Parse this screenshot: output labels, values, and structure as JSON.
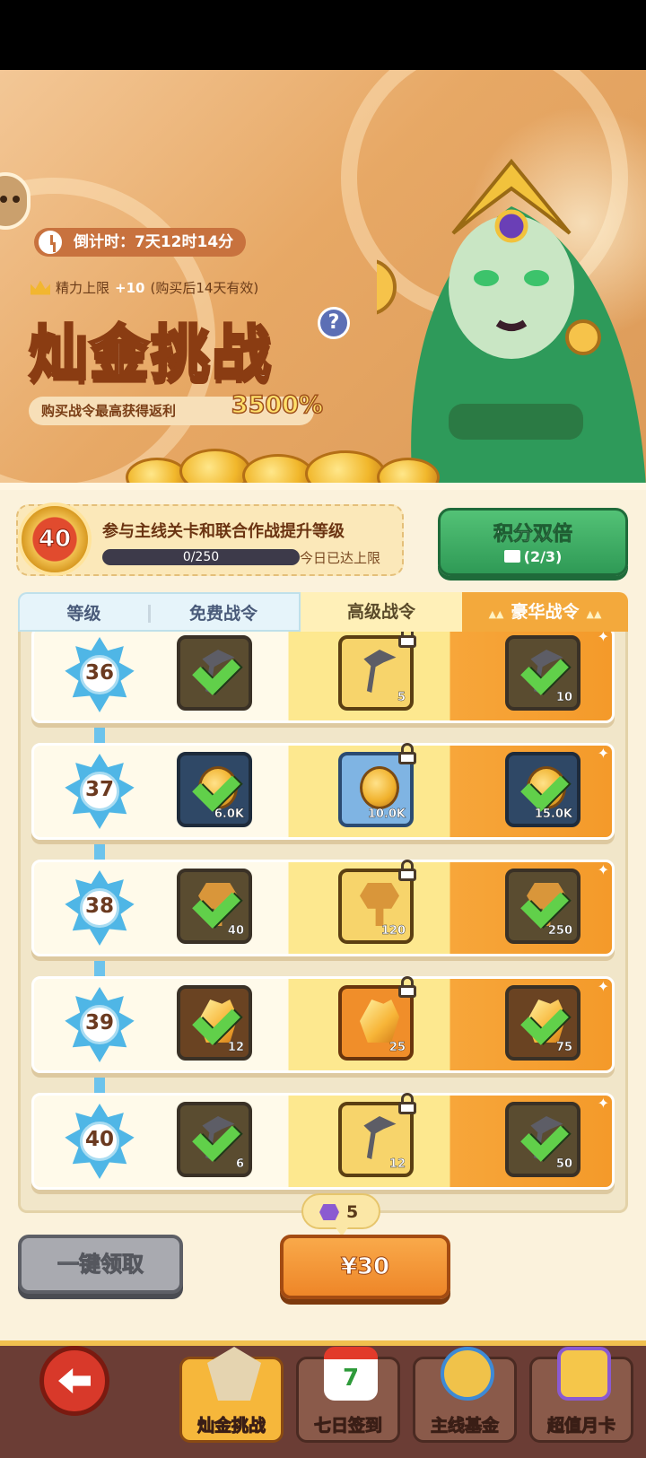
{
  "banner": {
    "countdown": "倒计时：7天12时14分",
    "stamina_label": "精力上限",
    "stamina_plus": "+10",
    "stamina_note": "(购买后14天有效)",
    "title": "灿金挑战",
    "help": "?",
    "rebate_text": "购买战令最高获得返利",
    "rebate_pct": "3500%"
  },
  "level_panel": {
    "level": "40",
    "description": "参与主线关卡和联合作战提升等级",
    "progress_text": "0/250",
    "progress_fraction": 0,
    "cap_text": "今日已达上限"
  },
  "double_points": {
    "label": "积分双倍",
    "count": "(2/3)"
  },
  "tabs": {
    "level": "等级",
    "free": "免费战令",
    "advanced": "高级战令",
    "luxury": "豪华战令"
  },
  "rows": [
    {
      "level": "36",
      "item": "pickaxe",
      "free": "",
      "advanced": "5",
      "luxury": "10"
    },
    {
      "level": "37",
      "item": "gold-coin",
      "free": "6.0K",
      "advanced": "10.0K",
      "luxury": "15.0K"
    },
    {
      "level": "38",
      "item": "key",
      "free": "40",
      "advanced": "120",
      "luxury": "250"
    },
    {
      "level": "39",
      "item": "crystal",
      "free": "12",
      "advanced": "25",
      "luxury": "75"
    },
    {
      "level": "40",
      "item": "pickaxe",
      "free": "6",
      "advanced": "12",
      "luxury": "50"
    }
  ],
  "actions": {
    "claim_all": "一键领取",
    "gem_count": "5",
    "price": "¥30"
  },
  "nav": {
    "items": [
      "灿金挑战",
      "七日签到",
      "主线基金",
      "超值月卡"
    ],
    "calendar_day": "7"
  },
  "colors": {
    "accent_orange": "#f49a2a",
    "check_green": "#61d04a",
    "level_star": "#4fb6e6"
  }
}
